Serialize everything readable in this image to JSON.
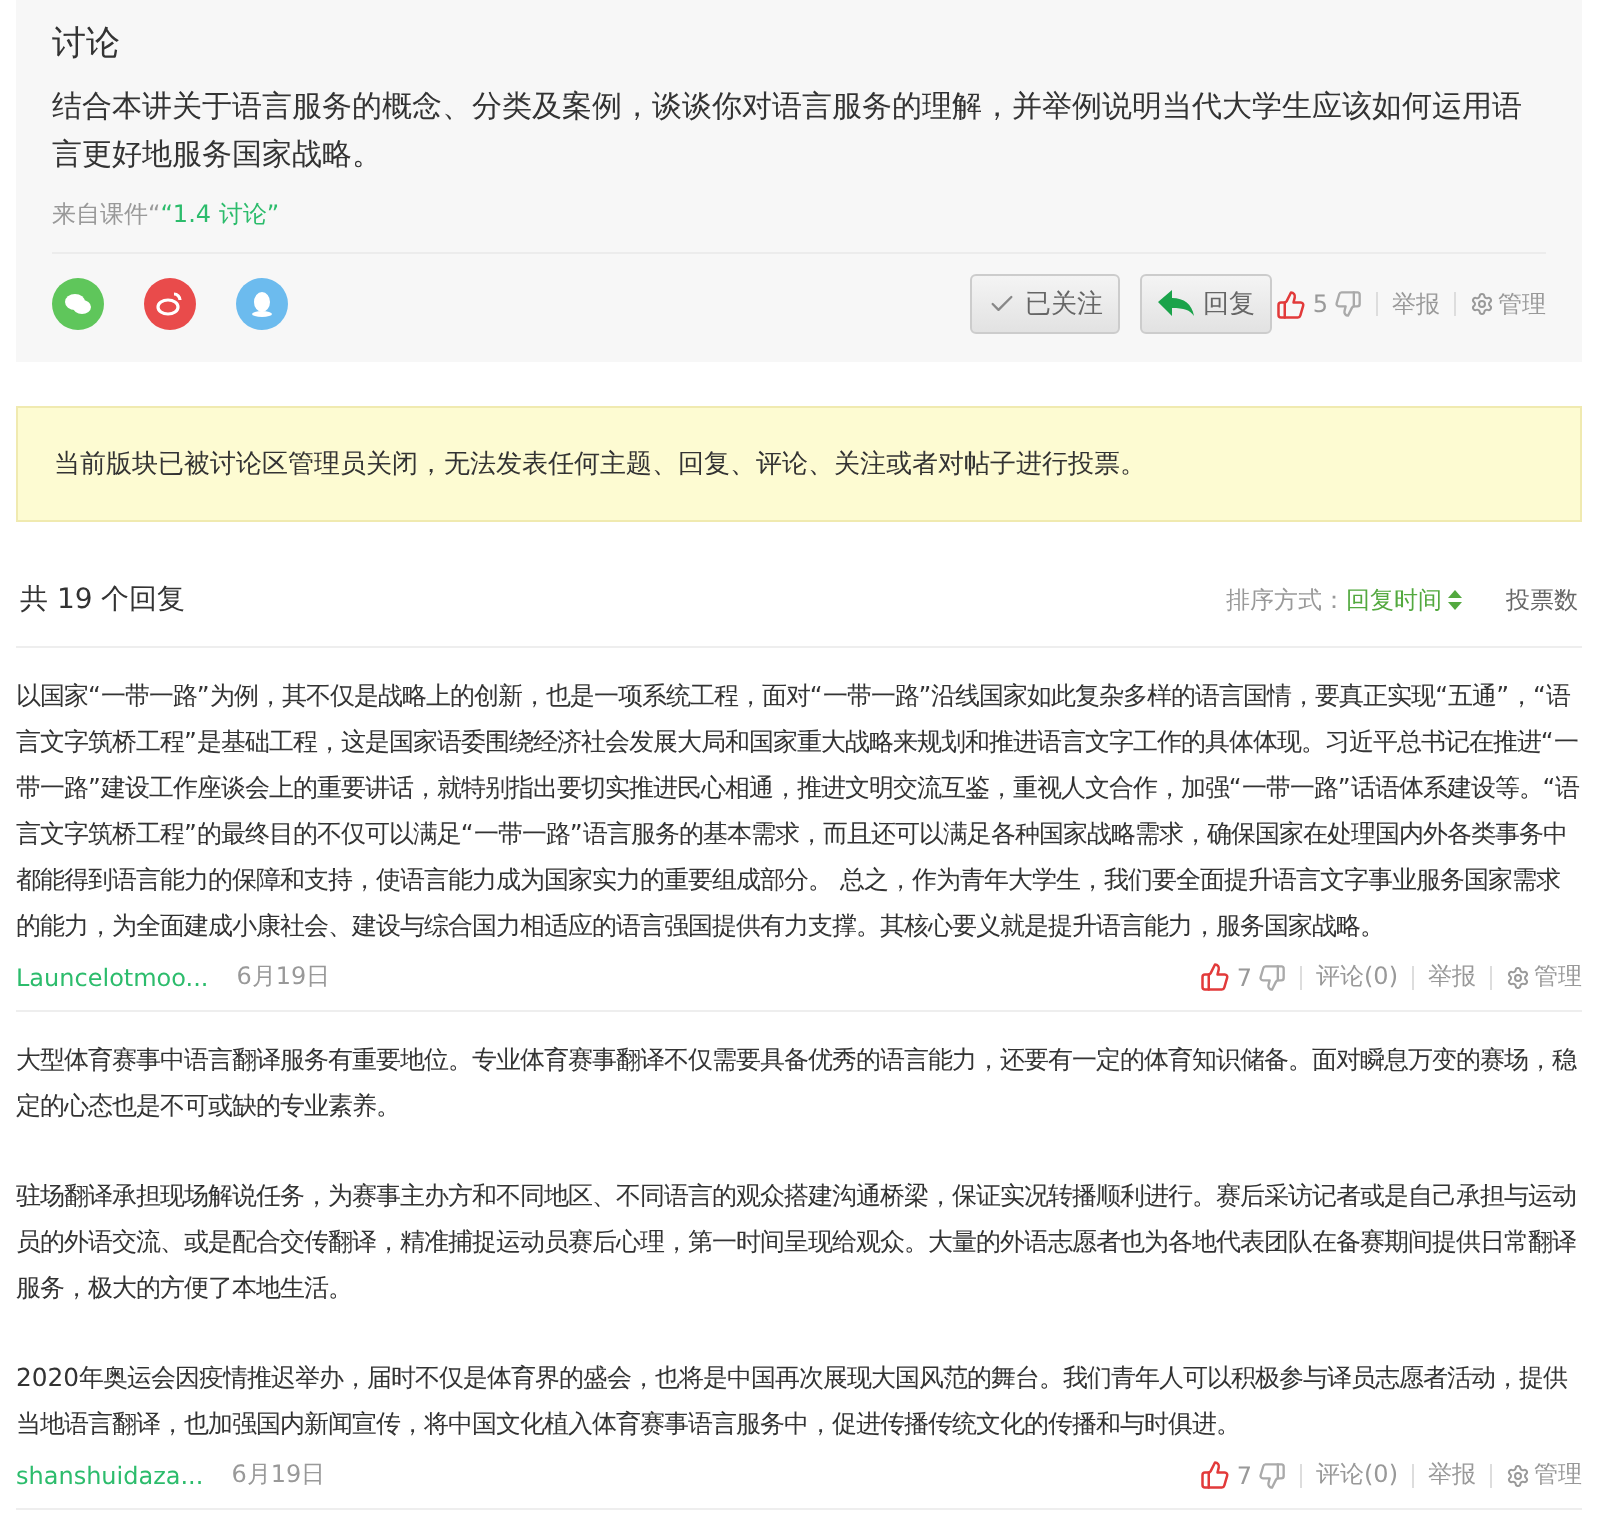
{
  "topic": {
    "title": "讨论",
    "question": "结合本讲关于语言服务的概念、分类及案例，谈谈你对语言服务的理解，并举例说明当代大学生应该如何运用语言更好地服务国家战略。",
    "source_prefix": "来自课件“",
    "source_link": "“1.4 讨论”",
    "share": [
      {
        "kind": "wechat"
      },
      {
        "kind": "weibo"
      },
      {
        "kind": "qq"
      }
    ],
    "follow_button": "已关注",
    "reply_button": "回复",
    "likes": "5",
    "report": "举报",
    "manage": "管理"
  },
  "notice": "当前版块已被讨论区管理员关闭，无法发表任何主题、回复、评论、关注或者对帖子进行投票。",
  "replies_header": {
    "count": "共 19 个回复",
    "sort_label": "排序方式：",
    "sorts": [
      {
        "label": "回复时间",
        "selected": true
      },
      {
        "label": "投票数",
        "selected": false
      }
    ]
  },
  "replies": [
    {
      "paragraphs": [
        "以国家“一带一路”为例，其不仅是战略上的创新，也是一项系统工程，面对“一带一路”沿线国家如此复杂多样的语言国情，要真正实现“五通”，“语言文字筑桥工程”是基础工程，这是国家语委围绕经济社会发展大局和国家重大战略来规划和推进语言文字工作的具体体现。习近平总书记在推进“一带一路”建设工作座谈会上的重要讲话，就特别指出要切实推进民心相通，推进文明交流互鉴，重视人文合作，加强“一带一路”话语体系建设等。“语言文字筑桥工程”的最终目的不仅可以满足“一带一路”语言服务的基本需求，而且还可以满足各种国家战略需求，确保国家在处理国内外各类事务中都能得到语言能力的保障和支持，使语言能力成为国家实力的重要组成部分。 总之，作为青年大学生，我们要全面提升语言文字事业服务国家需求的能力，为全面建成小康社会、建设与综合国力相适应的语言强国提供有力支撑。其核心要义就是提升语言能力，服务国家战略。"
      ],
      "author": "Launcelotmoo...",
      "date": "6月19日",
      "likes": "7",
      "comment": "评论(0)",
      "report": "举报",
      "manage": "管理"
    },
    {
      "paragraphs": [
        "大型体育赛事中语言翻译服务有重要地位。专业体育赛事翻译不仅需要具备优秀的语言能力，还要有一定的体育知识储备。面对瞬息万变的赛场，稳定的心态也是不可或缺的专业素养。",
        "驻场翻译承担现场解说任务，为赛事主办方和不同地区、不同语言的观众搭建沟通桥梁，保证实况转播顺利进行。赛后采访记者或是自己承担与运动员的外语交流、或是配合交传翻译，精准捕捉运动员赛后心理，第一时间呈现给观众。大量的外语志愿者也为各地代表团队在备赛期间提供日常翻译服务，极大的方便了本地生活。",
        "2020年奥运会因疫情推迟举办，届时不仅是体育界的盛会，也将是中国再次展现大国风范的舞台。我们青年人可以积极参与译员志愿者活动，提供当地语言翻译，也加强国内新闻宣传，将中国文化植入体育赛事语言服务中，促进传播传统文化的传播和与时俱进。"
      ],
      "author": "shanshuidaza...",
      "date": "6月19日",
      "likes": "7",
      "comment": "评论(0)",
      "report": "举报",
      "manage": "管理"
    }
  ]
}
